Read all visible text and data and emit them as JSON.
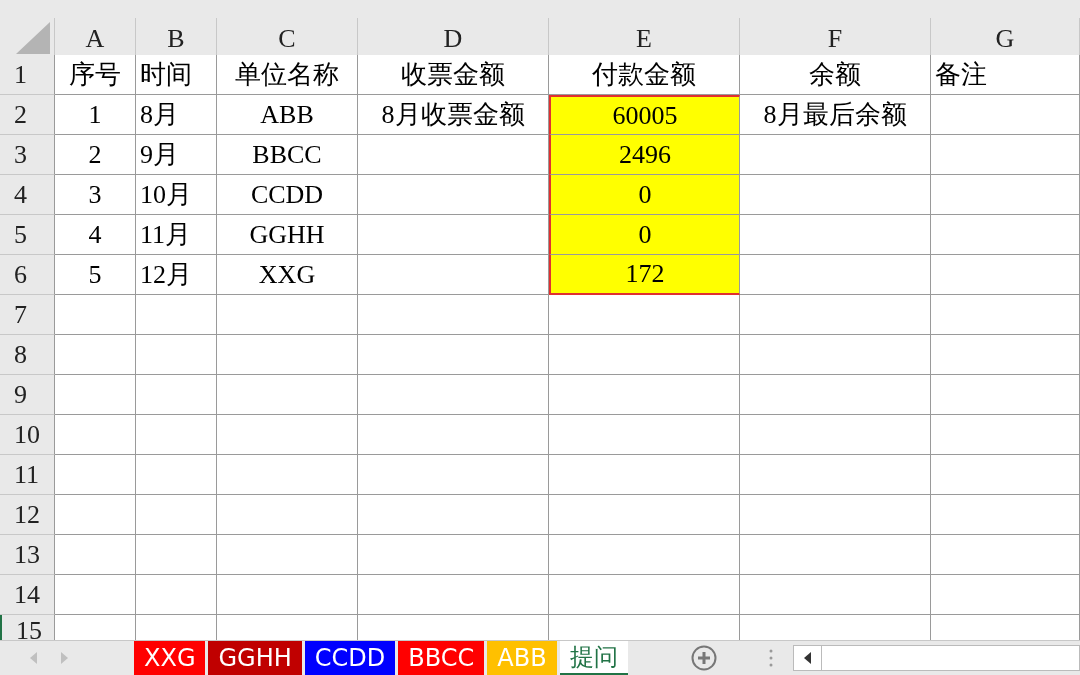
{
  "columns": [
    "A",
    "B",
    "C",
    "D",
    "E",
    "F",
    "G"
  ],
  "rows": [
    {
      "number": "1",
      "cells": [
        {
          "text": "序号",
          "highlighted": false,
          "selected": false
        },
        {
          "text": "时间",
          "highlighted": false,
          "selected": false
        },
        {
          "text": "单位名称",
          "highlighted": false,
          "selected": false
        },
        {
          "text": "收票金额",
          "highlighted": false,
          "selected": false
        },
        {
          "text": "付款金额",
          "highlighted": false,
          "selected": false
        },
        {
          "text": "余额",
          "highlighted": false,
          "selected": false
        },
        {
          "text": "备注",
          "highlighted": false,
          "selected": false
        }
      ]
    },
    {
      "number": "2",
      "cells": [
        {
          "text": "1",
          "highlighted": false,
          "selected": false
        },
        {
          "text": "8月",
          "highlighted": false,
          "selected": false
        },
        {
          "text": "ABB",
          "highlighted": false,
          "selected": false
        },
        {
          "text": "8月收票金额",
          "highlighted": false,
          "selected": false
        },
        {
          "text": "60005",
          "highlighted": true,
          "selected": true
        },
        {
          "text": "8月最后余额",
          "highlighted": false,
          "selected": false
        },
        {
          "highlighted": false,
          "selected": false
        }
      ]
    },
    {
      "number": "3",
      "cells": [
        {
          "text": "2",
          "highlighted": false,
          "selected": false
        },
        {
          "text": "9月",
          "highlighted": false,
          "selected": false
        },
        {
          "text": "BBCC",
          "highlighted": false,
          "selected": false
        },
        {
          "highlighted": false,
          "selected": false
        },
        {
          "text": "2496",
          "highlighted": true,
          "selected": true
        },
        {
          "highlighted": false,
          "selected": false
        },
        {
          "highlighted": false,
          "selected": false
        }
      ]
    },
    {
      "number": "4",
      "cells": [
        {
          "text": "3",
          "highlighted": false,
          "selected": false
        },
        {
          "text": "10月",
          "highlighted": false,
          "selected": false
        },
        {
          "text": "CCDD",
          "highlighted": false,
          "selected": false
        },
        {
          "highlighted": false,
          "selected": false
        },
        {
          "text": "0",
          "highlighted": true,
          "selected": true
        },
        {
          "highlighted": false,
          "selected": false
        },
        {
          "highlighted": false,
          "selected": false
        }
      ]
    },
    {
      "number": "5",
      "cells": [
        {
          "text": "4",
          "highlighted": false,
          "selected": false
        },
        {
          "text": "11月",
          "highlighted": false,
          "selected": false
        },
        {
          "text": "GGHH",
          "highlighted": false,
          "selected": false
        },
        {
          "highlighted": false,
          "selected": false
        },
        {
          "text": "0",
          "highlighted": true,
          "selected": true
        },
        {
          "highlighted": false,
          "selected": false
        },
        {
          "highlighted": false,
          "selected": false
        }
      ]
    },
    {
      "number": "6",
      "cells": [
        {
          "text": "5",
          "highlighted": false,
          "selected": false
        },
        {
          "text": "12月",
          "highlighted": false,
          "selected": false
        },
        {
          "text": "XXG",
          "highlighted": false,
          "selected": false
        },
        {
          "highlighted": false,
          "selected": false
        },
        {
          "text": "172",
          "highlighted": true,
          "selected": true
        },
        {
          "highlighted": false,
          "selected": false
        },
        {
          "highlighted": false,
          "selected": false
        }
      ]
    },
    {
      "number": "7"
    },
    {
      "number": "8"
    },
    {
      "number": "9"
    },
    {
      "number": "10"
    },
    {
      "number": "11"
    },
    {
      "number": "12"
    },
    {
      "number": "13"
    },
    {
      "number": "14"
    },
    {
      "number": "15"
    }
  ],
  "sheet_tabs": [
    {
      "name": "XXG",
      "color": "#ff0000",
      "selected": false
    },
    {
      "name": "GGHH",
      "color": "#c00000",
      "selected": false
    },
    {
      "name": "CCDD",
      "color": "#0000ff",
      "selected": false
    },
    {
      "name": "BBCC",
      "color": "#ff0000",
      "selected": false
    },
    {
      "name": "ABB",
      "color": "#ffc000",
      "selected": false
    },
    {
      "name": "提问",
      "color": "#ffffff",
      "selected": true
    }
  ]
}
